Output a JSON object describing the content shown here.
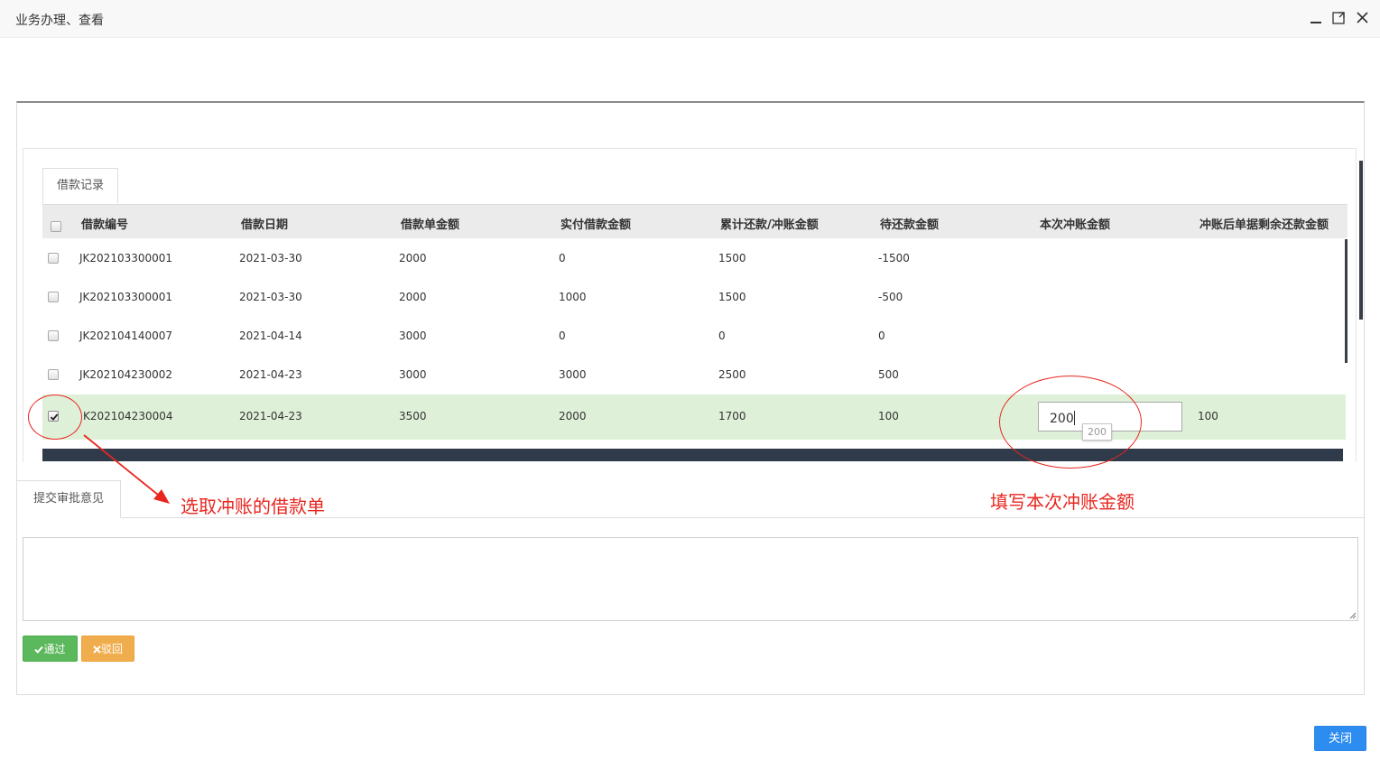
{
  "window": {
    "title": "业务办理、查看"
  },
  "tabs": {
    "loan_records": "借款记录",
    "approval_comment": "提交审批意见"
  },
  "grid": {
    "columns": [
      "借款编号",
      "借款日期",
      "借款单金额",
      "实付借款金额",
      "累计还款/冲账金额",
      "待还款金额",
      "本次冲账金额",
      "冲账后单据剩余还款金额"
    ],
    "rows": [
      {
        "id": "JK202103300001",
        "date": "2021-03-30",
        "amount": "2000",
        "paid": "0",
        "repaid": "1500",
        "due": "-1500",
        "offset": "",
        "remaining": "",
        "checked": false
      },
      {
        "id": "JK202103300001",
        "date": "2021-03-30",
        "amount": "2000",
        "paid": "1000",
        "repaid": "1500",
        "due": "-500",
        "offset": "",
        "remaining": "",
        "checked": false
      },
      {
        "id": "JK202104140007",
        "date": "2021-04-14",
        "amount": "3000",
        "paid": "0",
        "repaid": "0",
        "due": "0",
        "offset": "",
        "remaining": "",
        "checked": false
      },
      {
        "id": "JK202104230002",
        "date": "2021-04-23",
        "amount": "3000",
        "paid": "3000",
        "repaid": "2500",
        "due": "500",
        "offset": "",
        "remaining": "",
        "checked": false
      },
      {
        "id": "K202104230004",
        "date": "2021-04-23",
        "amount": "3500",
        "paid": "2000",
        "repaid": "1700",
        "due": "100",
        "offset": "200",
        "remaining": "100",
        "checked": true
      }
    ]
  },
  "input_tooltip": "200",
  "annotations": {
    "select_hint": "选取冲账的借款单",
    "fill_hint": "填写本次冲账金额",
    "color": "#e8261f"
  },
  "buttons": {
    "pass": "通过",
    "reject": "驳回",
    "close": "关闭"
  },
  "comment_value": ""
}
